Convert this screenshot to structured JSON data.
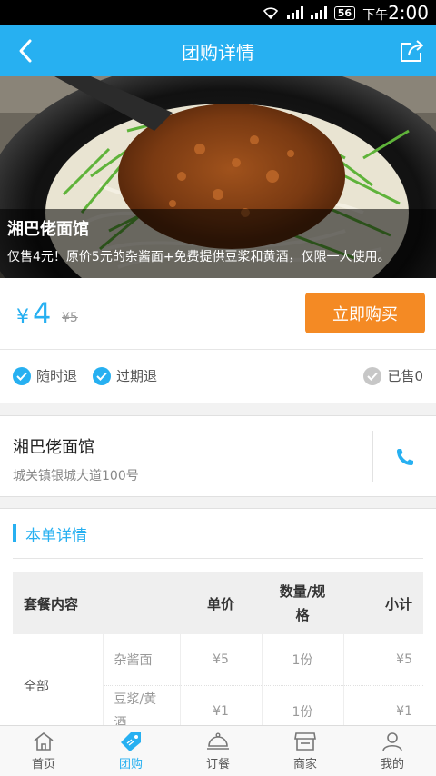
{
  "status_bar": {
    "network": "56",
    "ampm": "下午",
    "time": "2:00"
  },
  "header": {
    "title": "团购详情",
    "back_icon": "chevron-left-icon",
    "share_icon": "share-icon"
  },
  "hero": {
    "shop_name": "湘巴佬面馆",
    "description": "仅售4元！原价5元的杂酱面+免费提供豆浆和黄酒，仅限一人使用。"
  },
  "price": {
    "currency": "¥",
    "current": "4",
    "original": "¥5",
    "buy_label": "立即购买"
  },
  "tags": {
    "refund_anytime": "随时退",
    "refund_expired": "过期退",
    "sold": "已售0"
  },
  "shop": {
    "name": "湘巴佬面馆",
    "address": "城关镇银城大道100号",
    "phone_icon": "phone-icon"
  },
  "detail": {
    "title": "本单详情",
    "columns": [
      "套餐内容",
      "单价",
      "数量/规格",
      "小计"
    ],
    "group_label": "全部",
    "rows": [
      {
        "name": "杂酱面",
        "unit_price": "¥5",
        "qty": "1份",
        "subtotal": "¥5"
      },
      {
        "name": "豆浆/黄酒",
        "unit_price": "¥1",
        "qty": "1份",
        "subtotal": "¥1"
      }
    ]
  },
  "tabbar": {
    "items": [
      {
        "label": "首页",
        "icon": "home-icon"
      },
      {
        "label": "团购",
        "icon": "tag-icon"
      },
      {
        "label": "订餐",
        "icon": "dish-icon"
      },
      {
        "label": "商家",
        "icon": "store-icon"
      },
      {
        "label": "我的",
        "icon": "user-icon"
      }
    ],
    "active_index": 1
  },
  "colors": {
    "brand": "#27b0f1",
    "buy_button": "#f48a24"
  }
}
